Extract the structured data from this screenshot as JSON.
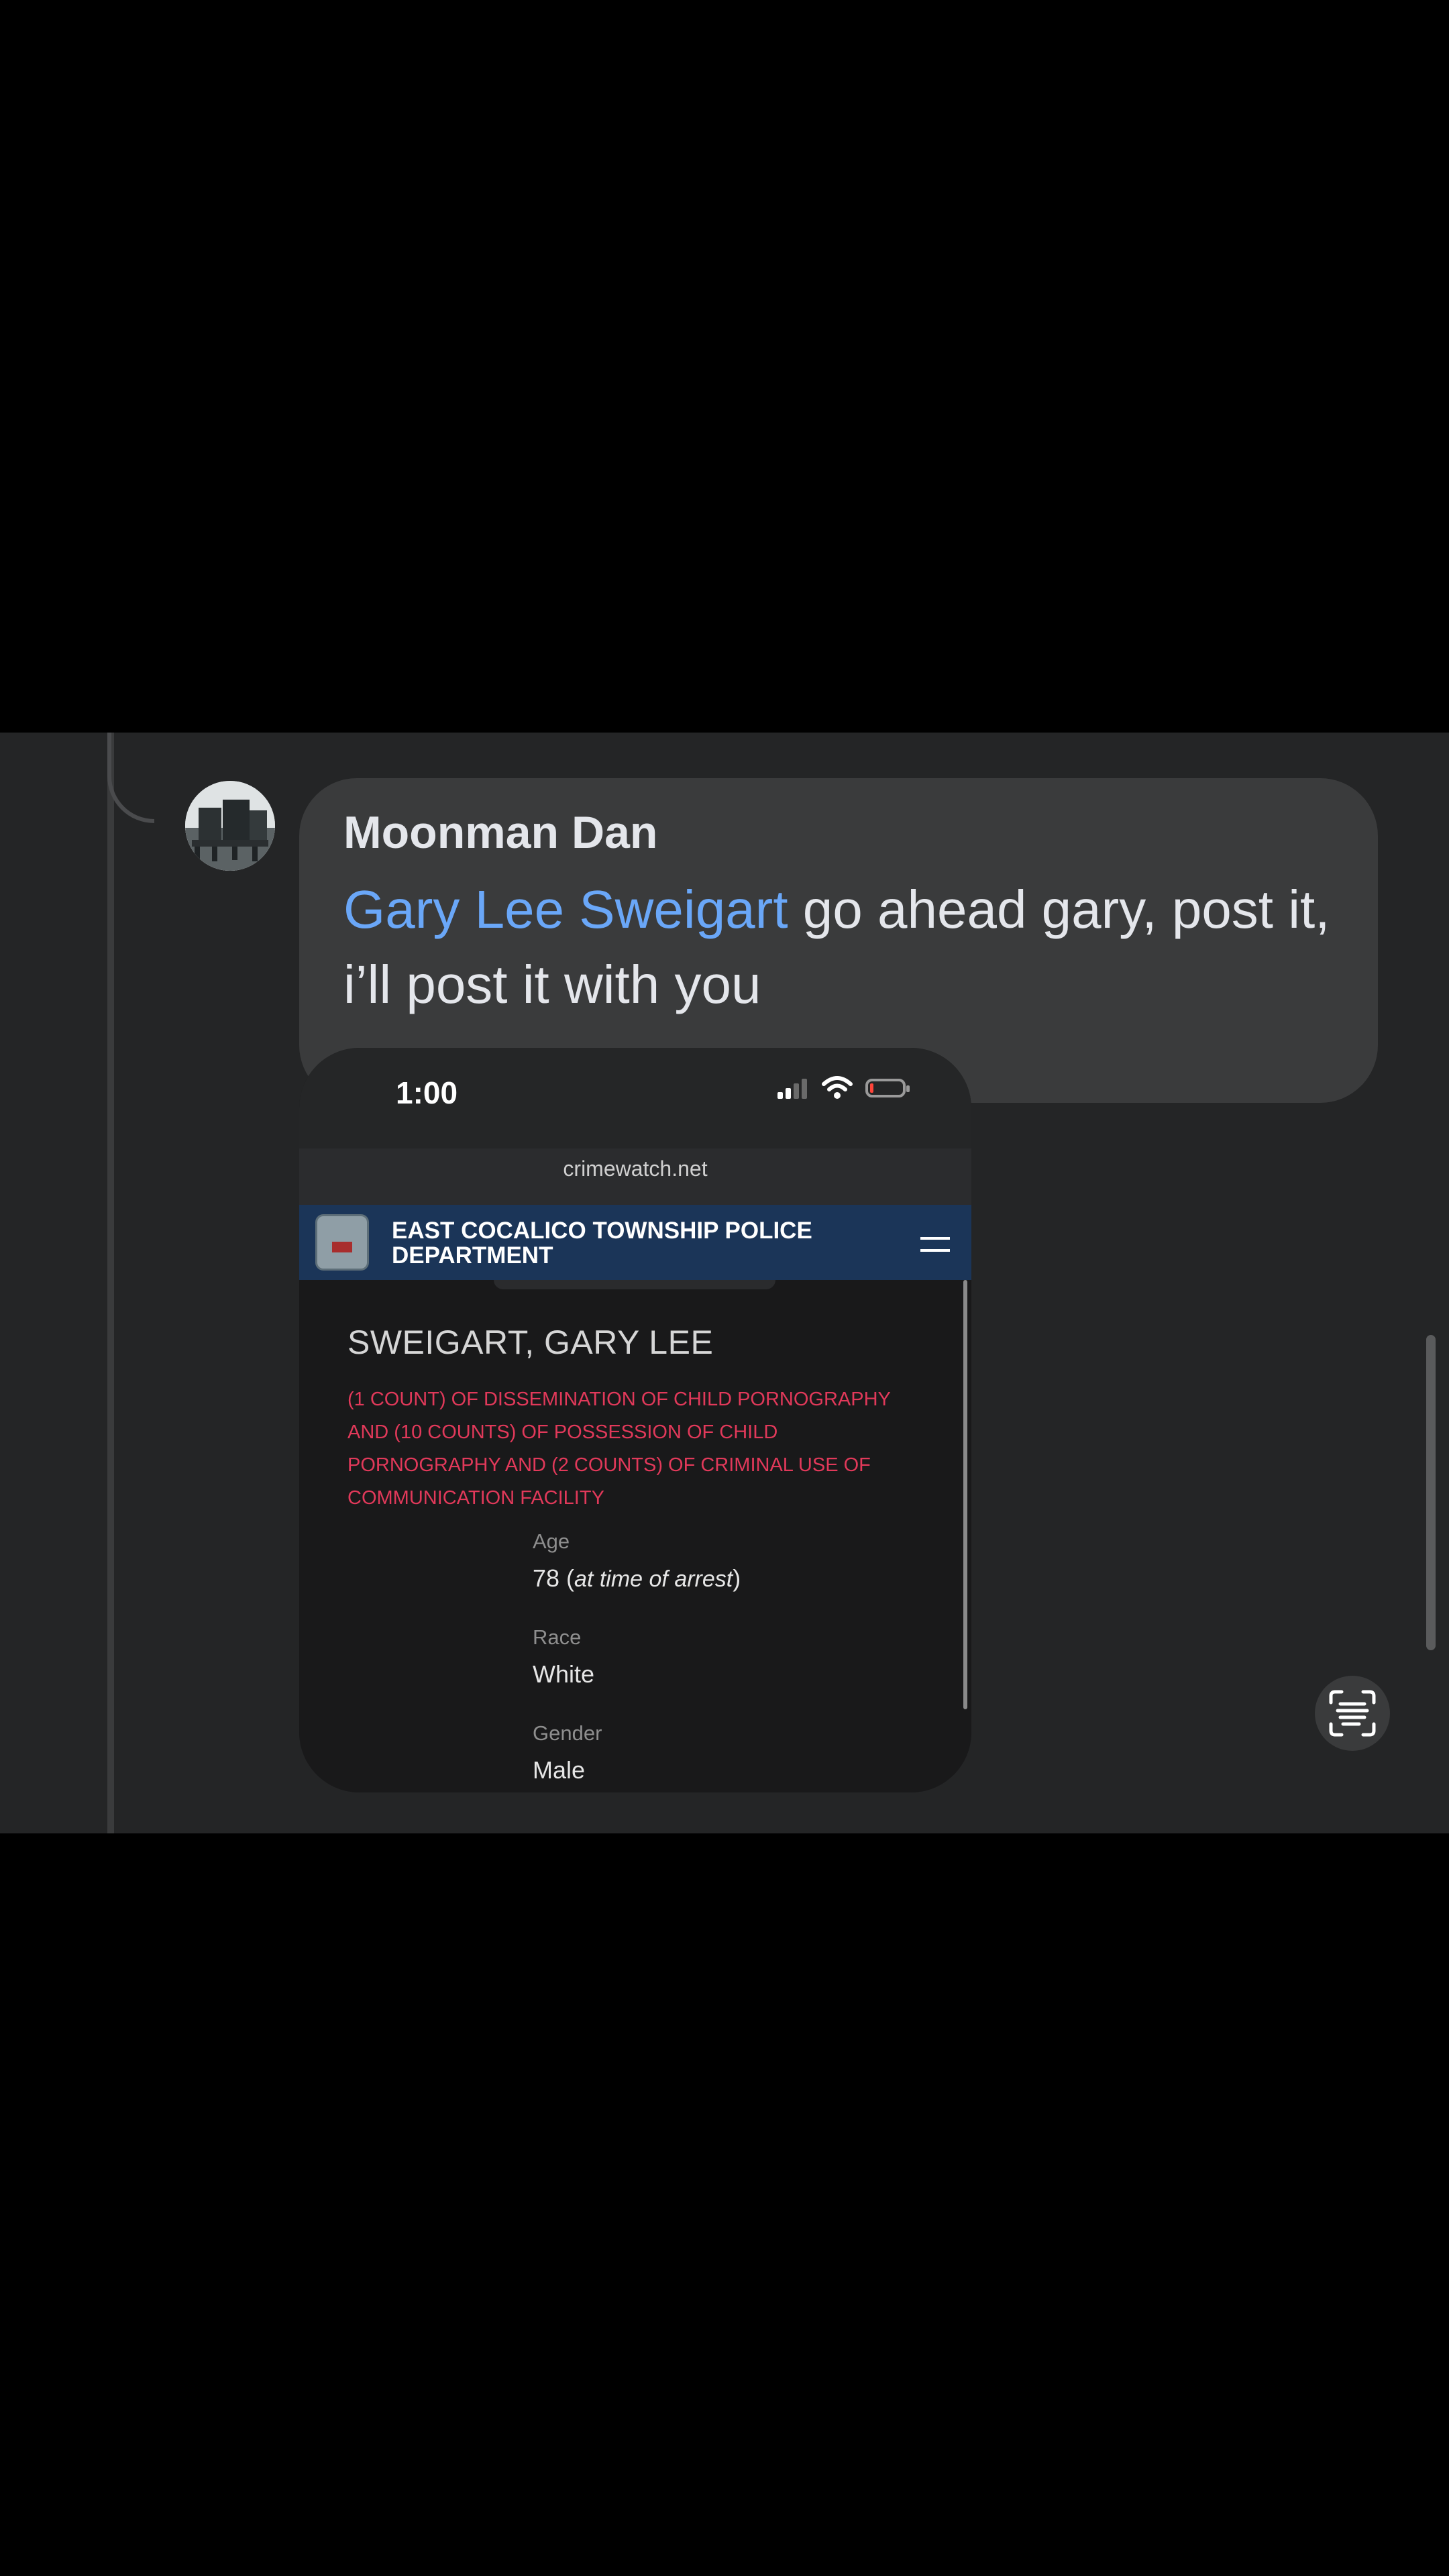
{
  "comment": {
    "author": "Moonman Dan",
    "mention": "Gary Lee Sweigart",
    "text": " go ahead gary, post it, i’ll post it with you"
  },
  "attachment": {
    "status_time": "1:00",
    "url": "crimewatch.net",
    "department": "EAST COCALICO TOWNSHIP POLICE DEPARTMENT",
    "person_name": "SWEIGART, GARY LEE",
    "charges": "(1 COUNT) OF DISSEMINATION OF CHILD PORNOGRAPHY AND (10 COUNTS) OF POSSESSION OF CHILD PORNOGRAPHY AND (2 COUNTS) OF CRIMINAL USE OF COMMUNICATION FACILITY",
    "fields": {
      "age_label": "Age",
      "age_value": "78",
      "age_note": "at time of arrest",
      "race_label": "Race",
      "race_value": "White",
      "gender_label": "Gender",
      "gender_value": "Male"
    }
  },
  "icons": {
    "signal": "signal-icon",
    "wifi": "wifi-icon",
    "battery": "battery-icon",
    "menu": "hamburger-menu-icon",
    "scan": "text-scan-icon"
  },
  "colors": {
    "mention": "#6aa7f8",
    "charges": "#e1395a",
    "dept_header": "#1b3558",
    "bubble": "#3a3b3c",
    "background": "#242526"
  }
}
